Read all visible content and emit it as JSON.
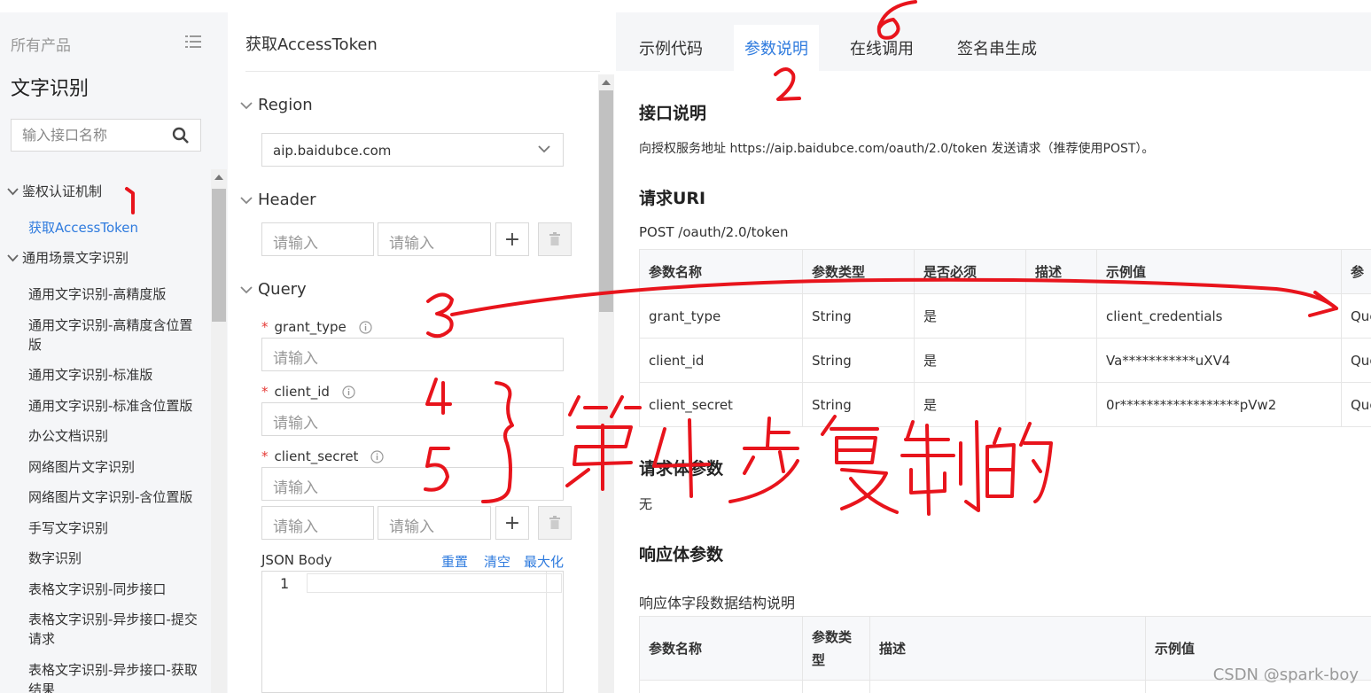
{
  "sidebar": {
    "all_products": "所有产品",
    "title": "文字识别",
    "search_placeholder": "输入接口名称",
    "groups": [
      {
        "label": "鉴权认证机制"
      },
      {
        "label": "通用场景文字识别"
      }
    ],
    "items": [
      {
        "label": "获取AccessToken",
        "active": true
      },
      {
        "label": "通用文字识别-高精度版"
      },
      {
        "label": "通用文字识别-高精度含位置版"
      },
      {
        "label": "通用文字识别-标准版"
      },
      {
        "label": "通用文字识别-标准含位置版"
      },
      {
        "label": "办公文档识别"
      },
      {
        "label": "网络图片文字识别"
      },
      {
        "label": "网络图片文字识别-含位置版"
      },
      {
        "label": "手写文字识别"
      },
      {
        "label": "数字识别"
      },
      {
        "label": "表格文字识别-同步接口"
      },
      {
        "label": "表格文字识别-异步接口-提交请求"
      },
      {
        "label": "表格文字识别-异步接口-获取结果"
      }
    ]
  },
  "middle": {
    "title": "获取AccessToken",
    "region_label": "Region",
    "region_value": "aip.baidubce.com",
    "header_label": "Header",
    "query_label": "Query",
    "input_placeholder": "请输入",
    "fields": [
      {
        "name": "grant_type"
      },
      {
        "name": "client_id"
      },
      {
        "name": "client_secret"
      }
    ],
    "json_body_label": "JSON Body",
    "json_actions": [
      "重置",
      "清空",
      "最大化"
    ],
    "line_number": "1"
  },
  "right": {
    "tabs": [
      {
        "label": "示例代码"
      },
      {
        "label": "参数说明",
        "active": true
      },
      {
        "label": "在线调用"
      },
      {
        "label": "签名串生成"
      }
    ],
    "api_desc_title": "接口说明",
    "api_desc_text": "向授权服务地址 https://aip.baidubce.com/oauth/2.0/token 发送请求（推荐使用POST）。",
    "uri_title": "请求URI",
    "uri_text": "POST /oauth/2.0/token",
    "request_table": {
      "headers": [
        "参数名称",
        "参数类型",
        "是否必须",
        "描述",
        "示例值",
        "参"
      ],
      "rows": [
        [
          "grant_type",
          "String",
          "是",
          "",
          "client_credentials",
          "Que"
        ],
        [
          "client_id",
          "String",
          "是",
          "",
          "Va***********uXV4",
          "Que"
        ],
        [
          "client_secret",
          "String",
          "是",
          "",
          "0r******************pVw2",
          "Que"
        ]
      ]
    },
    "body_params_title": "请求体参数",
    "body_params_text": "无",
    "response_title": "响应体参数",
    "response_subtitle": "响应体字段数据结构说明",
    "response_table": {
      "headers": [
        "参数名称",
        "参数类型",
        "描述",
        "示例值"
      ]
    }
  },
  "annotations": {
    "numbers": [
      "1",
      "2",
      "3",
      "4",
      "5",
      "6"
    ],
    "note": "第4步复制的",
    "color": "#e8141c"
  },
  "watermark": "CSDN @spark-boy"
}
